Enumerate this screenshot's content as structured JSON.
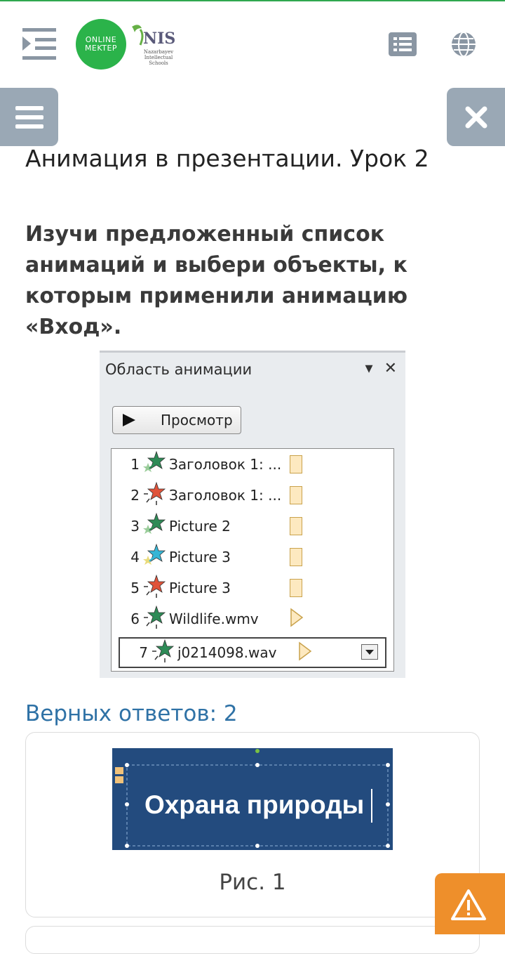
{
  "header": {
    "logo_line1": "ONLINE",
    "logo_line2": "MEKTEP",
    "nis_title": "NIS",
    "nis_subtitle": "Nazarbayev Intellectual Schools",
    "brand_color": "#2bb34a"
  },
  "lesson_title": "Анимация в презентации. Урок 2",
  "question": "Изучи предложенный список анимаций и выбери объекты, к которым применили анимацию «Вход».",
  "animation_pane": {
    "title": "Область анимации",
    "preview_label": "Просмотр",
    "items": [
      {
        "num": "1",
        "name": "Заголовок 1: ...",
        "marker": "box",
        "star": "green-fly"
      },
      {
        "num": "2",
        "name": "Заголовок 1: ...",
        "marker": "box",
        "star": "red-burst"
      },
      {
        "num": "3",
        "name": "Picture 2",
        "marker": "box",
        "star": "green-fly"
      },
      {
        "num": "4",
        "name": "Picture 3",
        "marker": "box",
        "star": "cyan-fly"
      },
      {
        "num": "5",
        "name": "Picture 3",
        "marker": "box",
        "star": "red-burst"
      },
      {
        "num": "6",
        "name": "Wildlife.wmv",
        "marker": "play",
        "star": "green-burst"
      },
      {
        "num": "7",
        "name": "j0214098.wav",
        "marker": "play",
        "star": "green-burst"
      }
    ]
  },
  "answers_label": "Верных ответов: 2",
  "option1": {
    "slide_text": "Охрана природы",
    "caption": "Рис. 1"
  },
  "colors": {
    "side_buttons": "#9aa8b5",
    "answers_label": "#2f72a6",
    "slide_bg": "#234b7e",
    "warning": "#ee8f2b"
  }
}
